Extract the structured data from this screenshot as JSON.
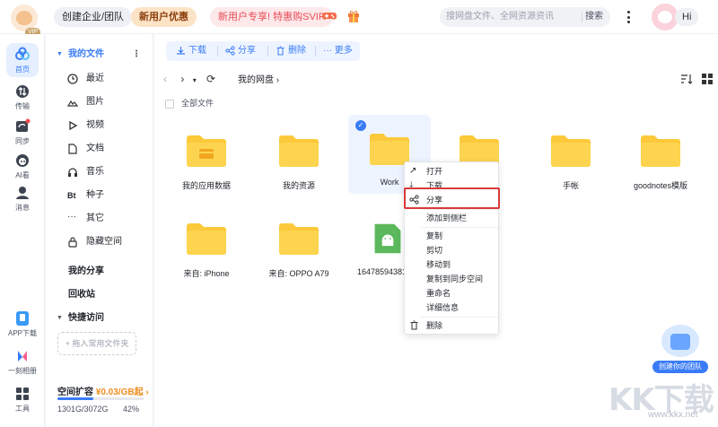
{
  "top": {
    "vip_badge": "VIP 7",
    "create_team": "创建企业/团队",
    "newuser_offer": "新用户优惠",
    "svip_promo": "新用户专享! 特惠购SVIP",
    "search_placeholder": "搜网盘文件、全网资源资讯",
    "search_button": "搜索",
    "greeting": "Hi"
  },
  "rail": [
    {
      "label": "首页",
      "icon": "cloud-home-icon"
    },
    {
      "label": "传输",
      "icon": "transfer-icon"
    },
    {
      "label": "同步",
      "icon": "sync-icon"
    },
    {
      "label": "AI看",
      "icon": "ai-icon"
    },
    {
      "label": "消息",
      "icon": "message-icon"
    },
    {
      "label": "APP下载",
      "icon": "app-download-icon"
    },
    {
      "label": "一刻相册",
      "icon": "album-icon"
    },
    {
      "label": "工具",
      "icon": "tools-icon"
    }
  ],
  "sidenav": {
    "my_files": "我的文件",
    "items": [
      {
        "label": "最近",
        "icon": "clock-icon"
      },
      {
        "label": "图片",
        "icon": "image-icon"
      },
      {
        "label": "视频",
        "icon": "video-icon"
      },
      {
        "label": "文档",
        "icon": "document-icon"
      },
      {
        "label": "音乐",
        "icon": "music-icon"
      },
      {
        "label": "种子",
        "icon": "bt-icon"
      },
      {
        "label": "其它",
        "icon": "more-dots-icon"
      },
      {
        "label": "隐藏空间",
        "icon": "lock-icon"
      }
    ],
    "my_share": "我的分享",
    "recycle": "回收站",
    "quick_access": "快捷访问",
    "pin_placeholder": "+ 拖入常用文件夹",
    "storage_title": "空间扩容",
    "storage_price": "¥0.03/GB起",
    "storage_used": "1301G/3072G",
    "storage_pct": "42%",
    "storage_fraction": 0.42
  },
  "toolbar": {
    "download": "下载",
    "share": "分享",
    "delete": "删除",
    "more": "更多"
  },
  "breadcrumb": "我的网盘",
  "all_files": "全部文件",
  "files": [
    {
      "name": "我的应用数据",
      "type": "folder-app"
    },
    {
      "name": "我的资源",
      "type": "folder"
    },
    {
      "name": "Work",
      "type": "folder",
      "selected": true
    },
    {
      "name": "",
      "type": "folder"
    },
    {
      "name": "手帐",
      "type": "folder"
    },
    {
      "name": "goodnotes模版",
      "type": "folder"
    },
    {
      "name": "来自: iPhone",
      "type": "folder"
    },
    {
      "name": "来自: OPPO A79",
      "type": "folder"
    },
    {
      "name": "16478594381",
      "type": "apk"
    }
  ],
  "context_menu": {
    "open": "打开",
    "download": "下载",
    "share": "分享",
    "add_sidebar": "添加到侧栏",
    "copy": "复制",
    "cut": "剪切",
    "move_to": "移动到",
    "copy_to_sync": "复制到同步空间",
    "rename": "重命名",
    "details": "详细信息",
    "delete": "删除"
  },
  "team_label": "创建你的团队",
  "watermark": "KK下载",
  "watermark_url": "www.kkx.net",
  "colors": {
    "accent": "#3a7cf7",
    "folder": "#fcc93a",
    "highlight": "#d93a3a"
  }
}
